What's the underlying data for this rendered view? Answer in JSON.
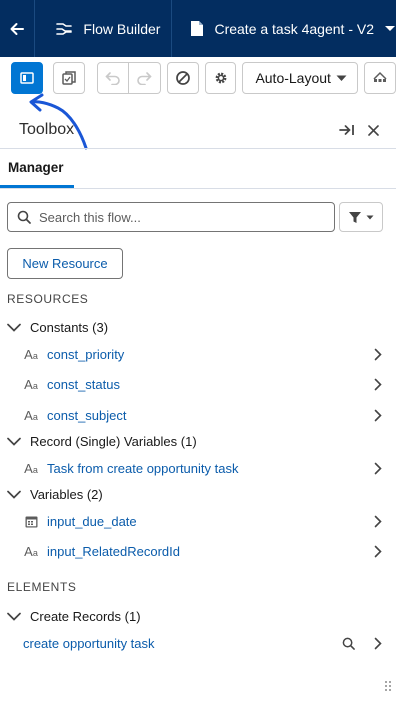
{
  "header": {
    "app_name": "Flow Builder",
    "flow_name": "Create a task 4agent - V2"
  },
  "toolbar": {
    "layout_select": "Auto-Layout"
  },
  "panel": {
    "title": "Toolbox",
    "tab": "Manager",
    "search_placeholder": "Search this flow...",
    "new_resource": "New Resource"
  },
  "resources": {
    "label": "RESOURCES",
    "groups": [
      {
        "label": "Constants (3)",
        "items": [
          "const_priority",
          "const_status",
          "const_subject"
        ]
      },
      {
        "label": "Record (Single) Variables (1)",
        "items": [
          "Task from create opportunity task"
        ]
      },
      {
        "label": "Variables (2)",
        "items": [
          "input_due_date",
          "input_RelatedRecordId"
        ]
      }
    ]
  },
  "elements": {
    "label": "ELEMENTS",
    "groups": [
      {
        "label": "Create Records (1)",
        "items": [
          "create opportunity task"
        ]
      }
    ]
  },
  "colors": {
    "nav_bg": "#032d60",
    "accent": "#0176d3",
    "link": "#0b5cab",
    "annotation_arrow": "#1a56d6"
  }
}
